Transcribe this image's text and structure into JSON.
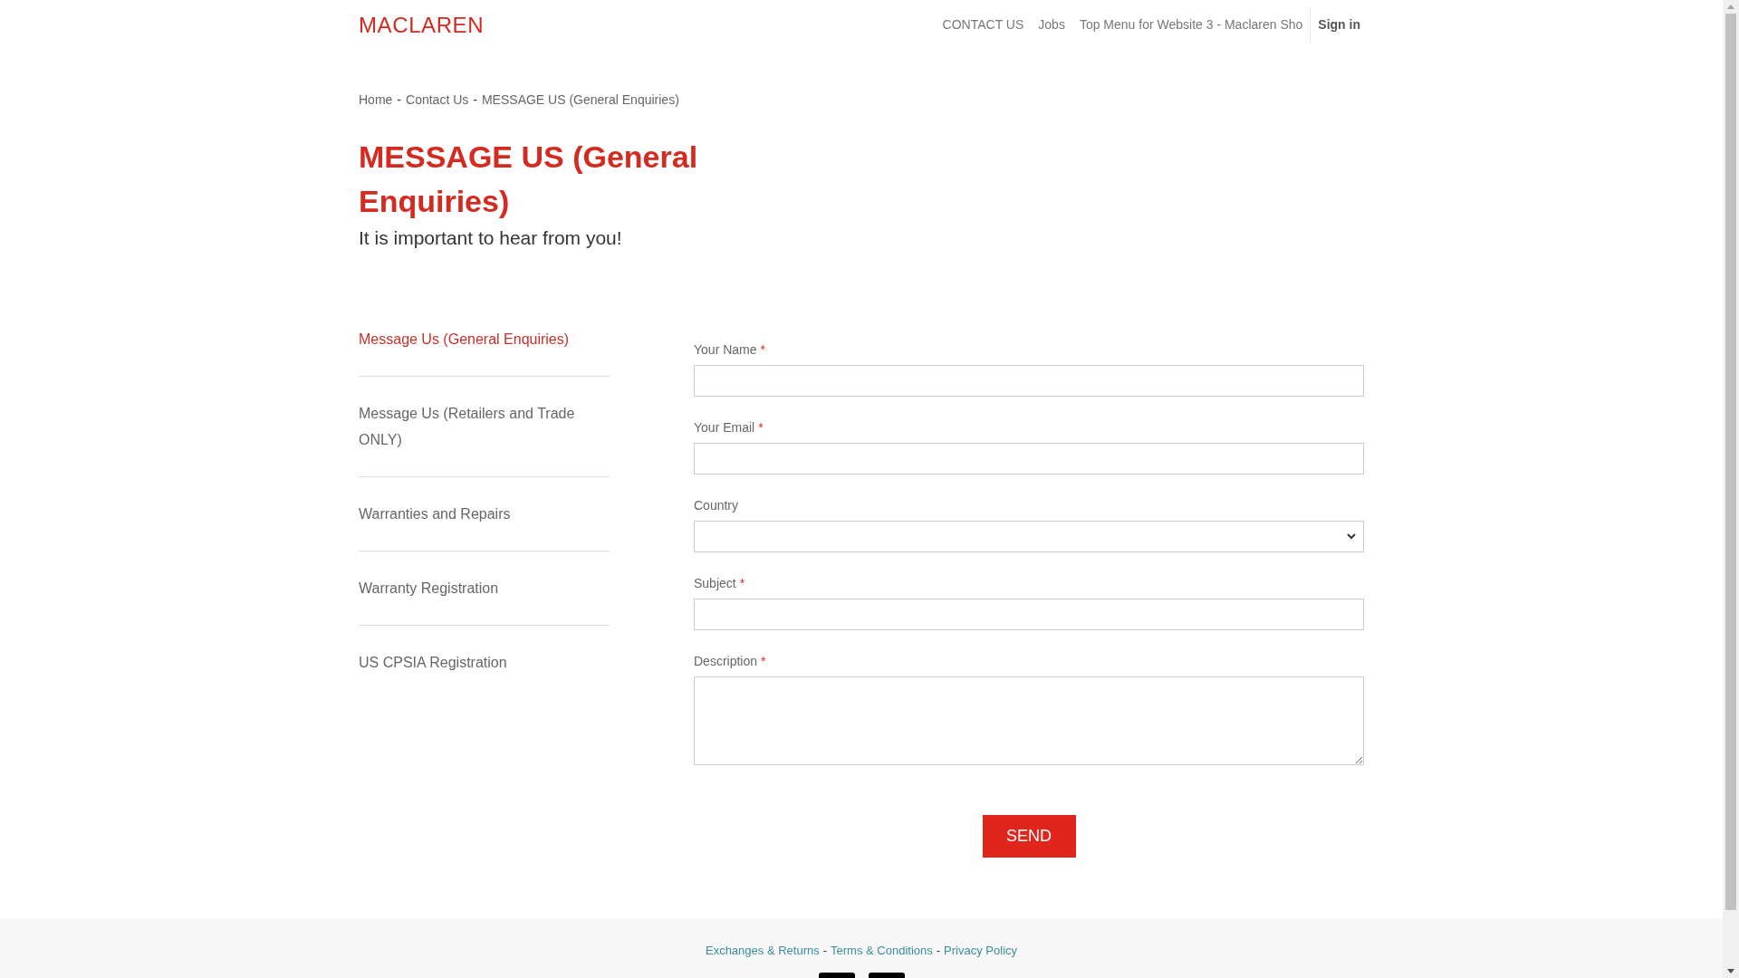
{
  "header": {
    "logo": "MACLAREN",
    "nav": [
      {
        "label": "CONTACT US",
        "kind": "link"
      },
      {
        "label": "Jobs",
        "kind": "link"
      },
      {
        "label": "Top Menu for Website 3 - Maclaren Sho",
        "kind": "link"
      },
      {
        "label": "Sign in",
        "kind": "signin"
      }
    ]
  },
  "breadcrumb": [
    {
      "label": "Home",
      "kind": "link"
    },
    {
      "label": "-",
      "kind": "sep"
    },
    {
      "label": "Contact Us",
      "kind": "link"
    },
    {
      "label": "-",
      "kind": "sep"
    },
    {
      "label": "MESSAGE US (General Enquiries)",
      "kind": "current"
    }
  ],
  "page": {
    "title": "MESSAGE US (General Enquiries)",
    "subtitle": "It is important to hear from you!"
  },
  "sidebar": {
    "items": [
      {
        "label": "Message Us (General Enquiries)",
        "selected": true
      },
      {
        "label": "Message Us (Retailers and Trade ONLY)",
        "selected": false
      },
      {
        "label": "Warranties and Repairs",
        "selected": false
      },
      {
        "label": "Warranty Registration",
        "selected": false
      },
      {
        "label": "US CPSIA Registration",
        "selected": false
      }
    ]
  },
  "form": {
    "fields": [
      {
        "label": "Your Name",
        "required": true,
        "kind": "text"
      },
      {
        "label": "Your Email",
        "required": true,
        "kind": "text"
      },
      {
        "label": "Country",
        "required": false,
        "kind": "select"
      },
      {
        "label": "Subject",
        "required": true,
        "kind": "text"
      },
      {
        "label": "Description",
        "required": true,
        "kind": "textarea"
      }
    ],
    "required_mark": "*",
    "submit": "SEND"
  },
  "footer": {
    "links": [
      {
        "label": "Exchanges & Returns",
        "kind": "link"
      },
      {
        "label": "-",
        "kind": "sep"
      },
      {
        "label": "Terms & Conditions",
        "kind": "link"
      },
      {
        "label": "-",
        "kind": "sep"
      },
      {
        "label": "Privacy Policy",
        "kind": "link"
      }
    ]
  }
}
